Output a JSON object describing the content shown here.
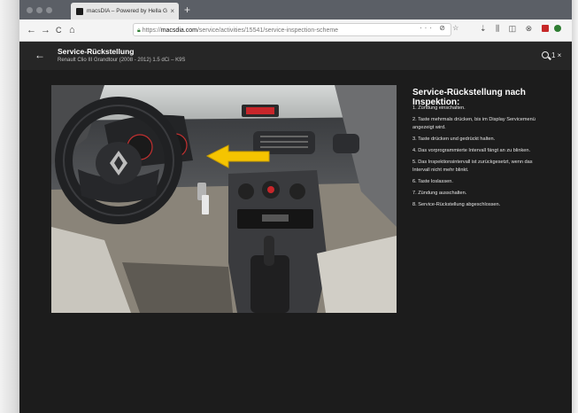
{
  "browser": {
    "tab_title": "macsDIA – Powered by Hella G",
    "tab_close": "×",
    "new_tab": "+",
    "nav": {
      "back": "←",
      "forward": "→",
      "reload": "C",
      "home": "⌂"
    },
    "url_prefix": "https://",
    "url_host": "macsdia.com",
    "url_path": "/service/activities/15541/service-inspection-scheme",
    "url_actions": "··· ⊘ ☆",
    "toolbar_icons": "⇣ ⫼ ◫ ⊗"
  },
  "header": {
    "back": "←",
    "title": "Service-Rückstellung",
    "subtitle": "Renault Clio III Grandtour (2008 - 2012) 1.5 dCi – K9S",
    "zoom": "1 ×"
  },
  "instructions": {
    "title": "Service-Rückstellung nach Inspektion:",
    "steps": [
      [
        "1. Zündung einschalten."
      ],
      [
        "2. Taste mehrmals drücken, bis im Display Servicemenü",
        "angezeigt wird."
      ],
      [
        "3. Taste drücken und gedrückt halten."
      ],
      [
        "4. Das vorprogrammierte Intervall fängt an zu blinken."
      ],
      [
        "5. Das Inspektionsintervall ist zurückgesetzt, wenn das",
        "Intervall nicht mehr blinkt."
      ],
      [
        "6. Taste loslassen."
      ],
      [
        "7. Zündung ausschalten."
      ],
      [
        "8. Service-Rückstellung abgeschlossen."
      ]
    ]
  },
  "colors": {
    "arrow": "#f5c400",
    "background": "#1c1c1c",
    "accent_red": "#e02020"
  }
}
